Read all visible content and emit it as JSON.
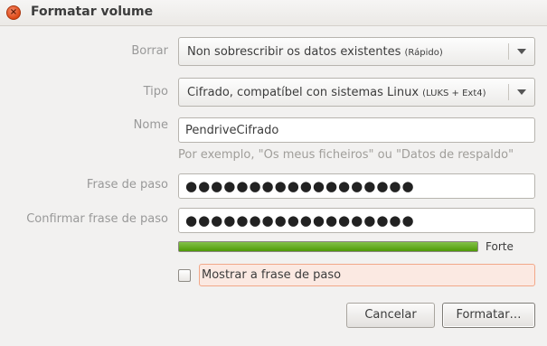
{
  "window": {
    "title": "Formatar volume",
    "close_glyph": "×"
  },
  "form": {
    "erase": {
      "label": "Borrar",
      "value": "Non sobrescribir os datos existentes",
      "value_note": "(Rápido)"
    },
    "type": {
      "label": "Tipo",
      "value": "Cifrado, compatíbel con sistemas Linux",
      "value_note": "(LUKS + Ext4)"
    },
    "name": {
      "label": "Nome",
      "value": "PendriveCifrado",
      "hint": "Por exemplo, \"Os meus ficheiros\" ou \"Datos de respaldo\""
    },
    "passphrase": {
      "label": "Frase de paso",
      "masked": "●●●●●●●●●●●●●●●●●●"
    },
    "confirm_passphrase": {
      "label": "Confirmar frase de paso",
      "masked": "●●●●●●●●●●●●●●●●●●"
    },
    "strength": {
      "label": "Forte",
      "level_percent": 100,
      "color": "#4e9a06"
    },
    "show_passphrase": {
      "label": "Mostrar a frase de paso",
      "checked": false
    }
  },
  "buttons": {
    "cancel": "Cancelar",
    "format": "Formatar…"
  },
  "colors": {
    "accent": "#dd4814",
    "highlight_bg": "#fbe9e2",
    "highlight_border": "#f2a889"
  }
}
